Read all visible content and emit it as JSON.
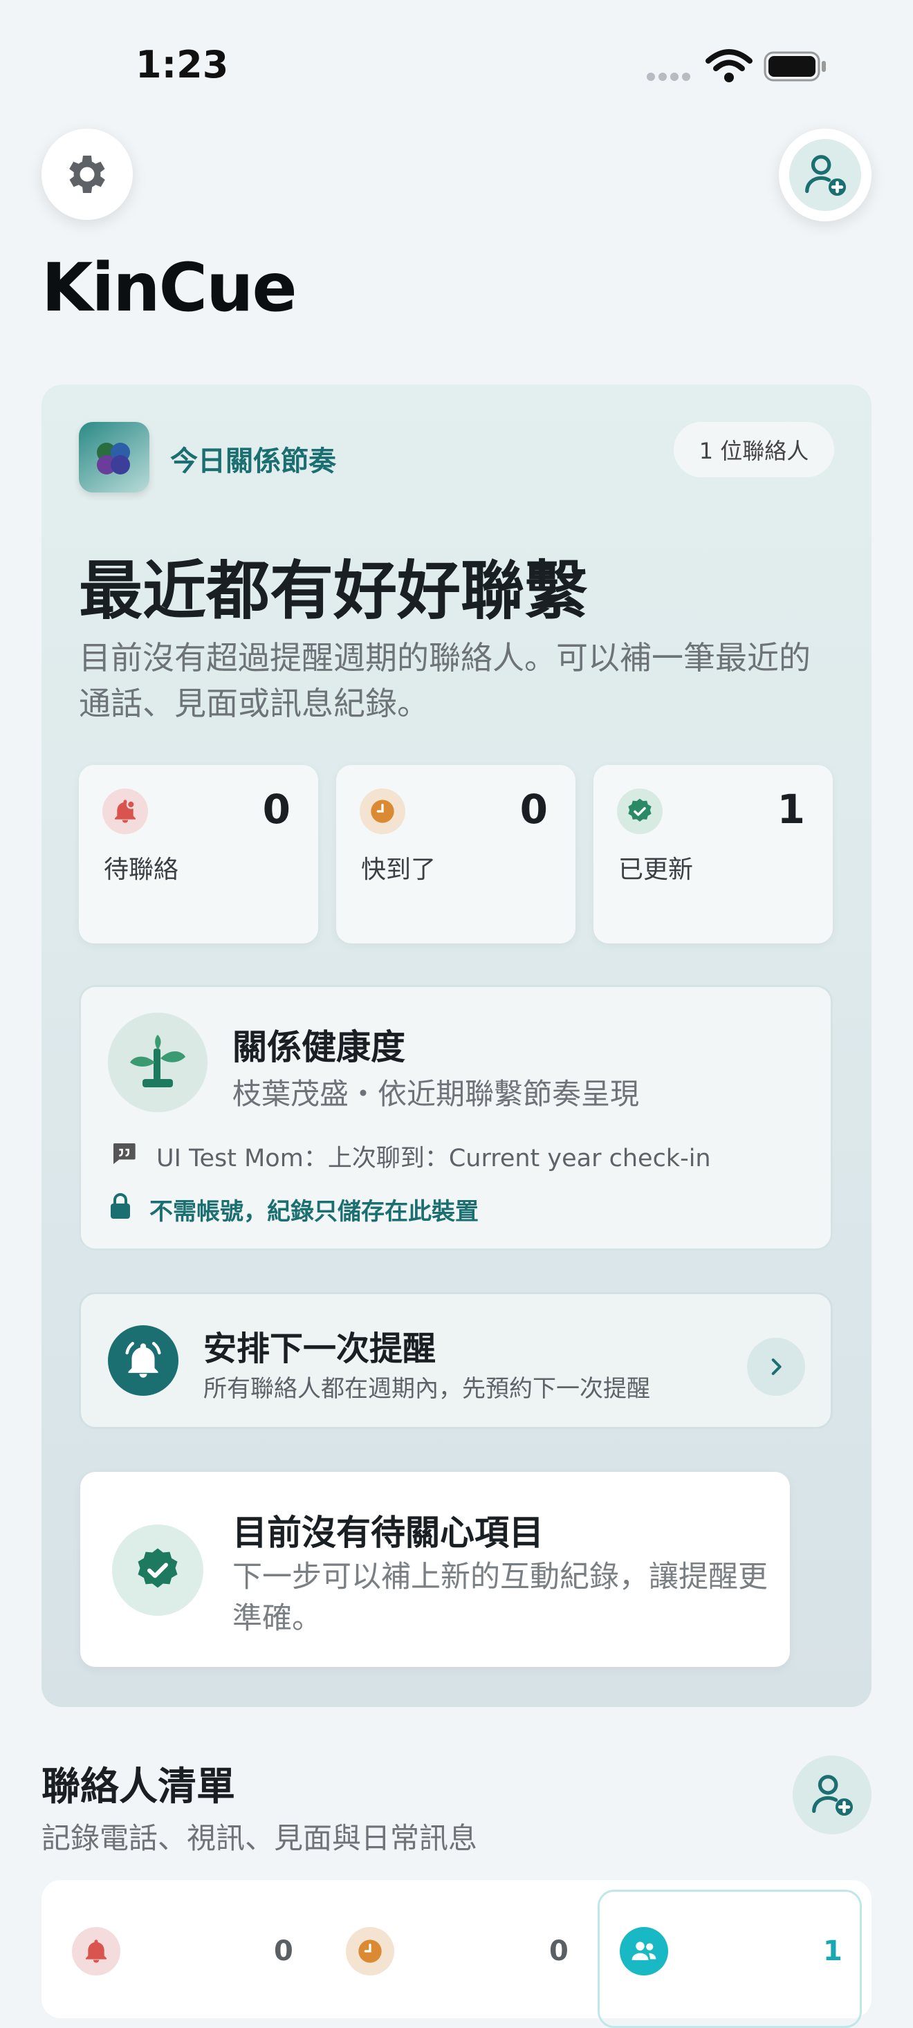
{
  "status_bar": {
    "time": "1:23"
  },
  "header": {
    "app_title": "KinCue"
  },
  "hero": {
    "label": "今日關係節奏",
    "contact_count": "1 位聯絡人",
    "title": "最近都有好好聯繫",
    "subtitle": "目前沒有超過提醒週期的聯絡人。可以補一筆最近的通話、見面或訊息紀錄。"
  },
  "stats": [
    {
      "icon": "bell-icon",
      "value": "0",
      "label": "待聯絡",
      "color": "#d9534f"
    },
    {
      "icon": "clock-icon",
      "value": "0",
      "label": "快到了",
      "color": "#d98a32"
    },
    {
      "icon": "check-badge-icon",
      "value": "1",
      "label": "已更新",
      "color": "#2a8a66"
    }
  ],
  "health": {
    "title": "關係健康度",
    "subtitle": "枝葉茂盛・依近期聯繫節奏呈現",
    "note": "UI Test Mom：上次聊到：Current year check-in",
    "privacy": "不需帳號，紀錄只儲存在此裝置"
  },
  "schedule": {
    "title": "安排下一次提醒",
    "subtitle": "所有聯絡人都在週期內，先預約下一次提醒"
  },
  "empty_state": {
    "title": "目前沒有待關心項目",
    "subtitle": "下一步可以補上新的互動紀錄，讓提醒更準確。"
  },
  "contacts": {
    "title": "聯絡人清單",
    "subtitle": "記錄電話、視訊、見面與日常訊息",
    "filters": [
      {
        "icon": "bell-icon",
        "value": "0"
      },
      {
        "icon": "clock-icon",
        "value": "0"
      },
      {
        "icon": "people-icon",
        "value": "1"
      }
    ]
  },
  "colors": {
    "accent": "#1b6f71",
    "background": "#f1f5f7"
  }
}
